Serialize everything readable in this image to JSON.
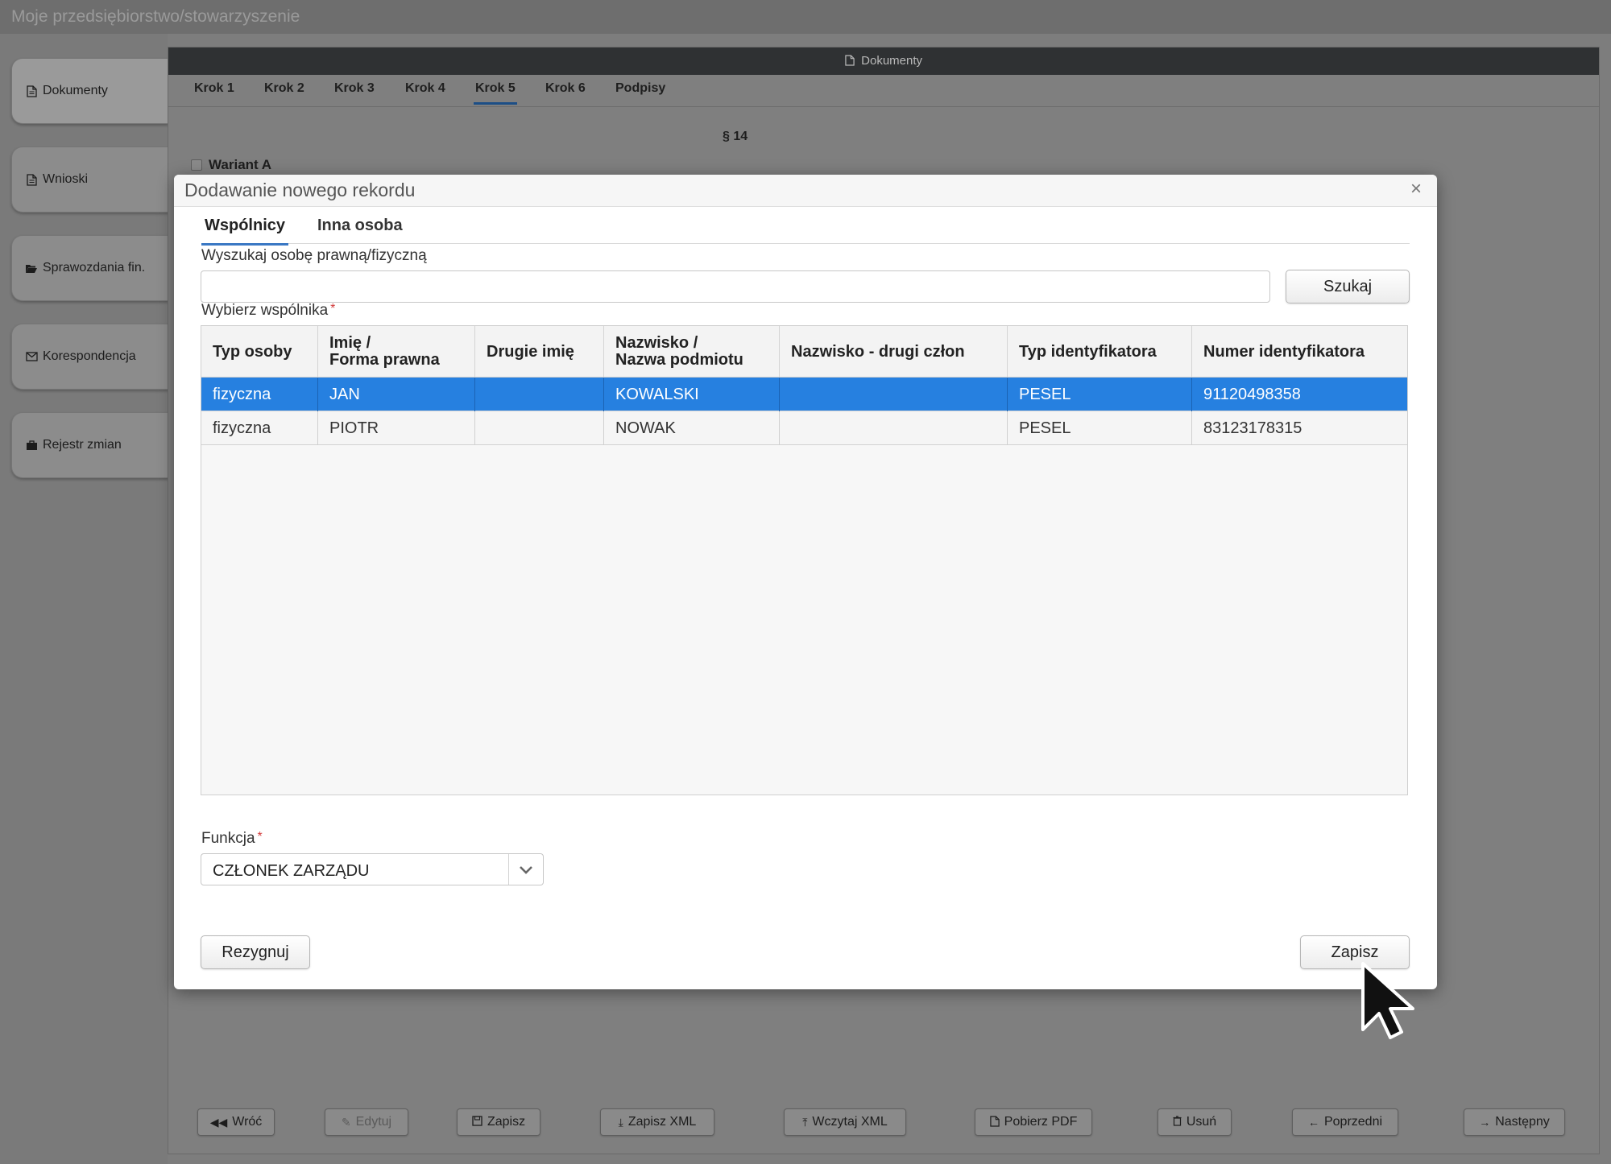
{
  "app": {
    "title": "Moje przedsiębiorstwo/stowarzyszenie"
  },
  "sidebar": {
    "items": [
      {
        "label": "Dokumenty",
        "icon": "document-icon"
      },
      {
        "label": "Wnioski",
        "icon": "document-icon"
      },
      {
        "label": "Sprawozdania fin.",
        "icon": "folder-open-icon"
      },
      {
        "label": "Korespondencja",
        "icon": "envelope-icon"
      },
      {
        "label": "Rejestr zmian",
        "icon": "briefcase-icon"
      }
    ]
  },
  "document": {
    "header": "Dokumenty",
    "steps": [
      "Krok 1",
      "Krok 2",
      "Krok 3",
      "Krok 4",
      "Krok 5",
      "Krok 6",
      "Podpisy"
    ],
    "active_step": "Krok 5",
    "section": "§ 14",
    "variant_label": "Wariant A"
  },
  "bottom_bar": {
    "back": "Wróć",
    "edit": "Edytuj",
    "save": "Zapisz",
    "save_xml": "Zapisz XML",
    "load_xml": "Wczytaj XML",
    "download_pdf": "Pobierz PDF",
    "delete": "Usuń",
    "previous": "Poprzedni",
    "next": "Następny"
  },
  "modal": {
    "title": "Dodawanie nowego rekordu",
    "close": "×",
    "tabs": [
      "Wspólnicy",
      "Inna osoba"
    ],
    "active_tab": "Wspólnicy",
    "search_label": "Wyszukaj osobę prawną/fizyczną",
    "search_value": "",
    "search_button": "Szukaj",
    "select_label": "Wybierz wspólnika",
    "required_mark": "*",
    "grid": {
      "columns": [
        [
          "Typ osoby"
        ],
        [
          "Imię /",
          "Forma prawna"
        ],
        [
          "Drugie imię"
        ],
        [
          "Nazwisko /",
          "Nazwa podmiotu"
        ],
        [
          "Nazwisko - drugi człon"
        ],
        [
          "Typ identyfikatora"
        ],
        [
          "Numer identyfikatora"
        ]
      ],
      "rows": [
        [
          "fizyczna",
          "JAN",
          "",
          "KOWALSKI",
          "",
          "PESEL",
          "91120498358"
        ],
        [
          "fizyczna",
          "PIOTR",
          "",
          "NOWAK",
          "",
          "PESEL",
          "83123178315"
        ]
      ],
      "selected_row": 0
    },
    "function_label": "Funkcja",
    "function_value": "CZŁONEK ZARZĄDU",
    "cancel_button": "Rezygnuj",
    "save_button": "Zapisz"
  },
  "colors": {
    "selected_row": "#2680e0",
    "tab_underline": "#3a78c4",
    "required": "#d23b3b",
    "header_bar": "#2f3133"
  }
}
